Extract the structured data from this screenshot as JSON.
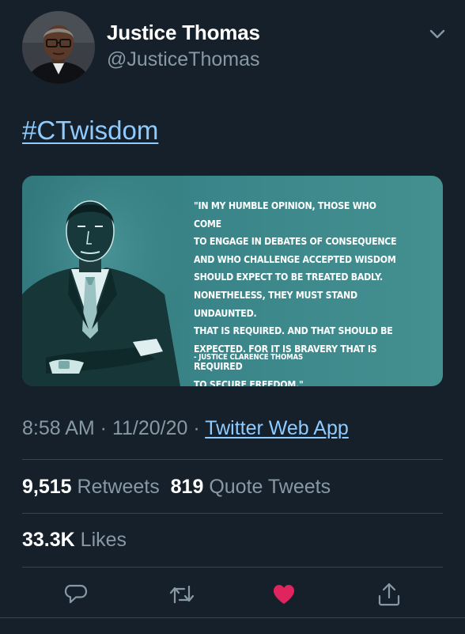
{
  "tweet": {
    "display_name": "Justice Thomas",
    "handle": "@JusticeThomas",
    "hashtag": "#CTwisdom",
    "media": {
      "quote": "\"IN MY HUMBLE OPINION, THOSE WHO COME\nTO ENGAGE IN DEBATES OF CONSEQUENCE\nAND WHO CHALLENGE ACCEPTED WISDOM\nSHOULD EXPECT TO BE TREATED BADLY.\nNONETHELESS, THEY MUST STAND UNDAUNTED.\nTHAT IS REQUIRED. AND THAT SHOULD BE\nEXPECTED. FOR IT IS BRAVERY THAT IS REQUIRED\nTO SECURE FREEDOM.\"",
      "attribution": "- JUSTICE CLARENCE THOMAS"
    },
    "meta": {
      "time": "8:58 AM",
      "separator": " · ",
      "date": "11/20/20",
      "source": "Twitter Web App"
    },
    "stats": {
      "retweets_count": "9,515",
      "retweets_label": "Retweets",
      "quotes_count": "819",
      "quotes_label": "Quote Tweets",
      "likes_count": "33.3K",
      "likes_label": "Likes"
    },
    "actions": {
      "reply_icon": "reply-icon",
      "retweet_icon": "retweet-icon",
      "like_icon": "heart-icon",
      "share_icon": "share-icon"
    }
  },
  "colors": {
    "background": "#15202b",
    "link": "#8ecbff",
    "secondary_text": "#8899a6",
    "divider": "#38444d",
    "like_active": "#e0245e",
    "media_teal": "#3a8589"
  }
}
